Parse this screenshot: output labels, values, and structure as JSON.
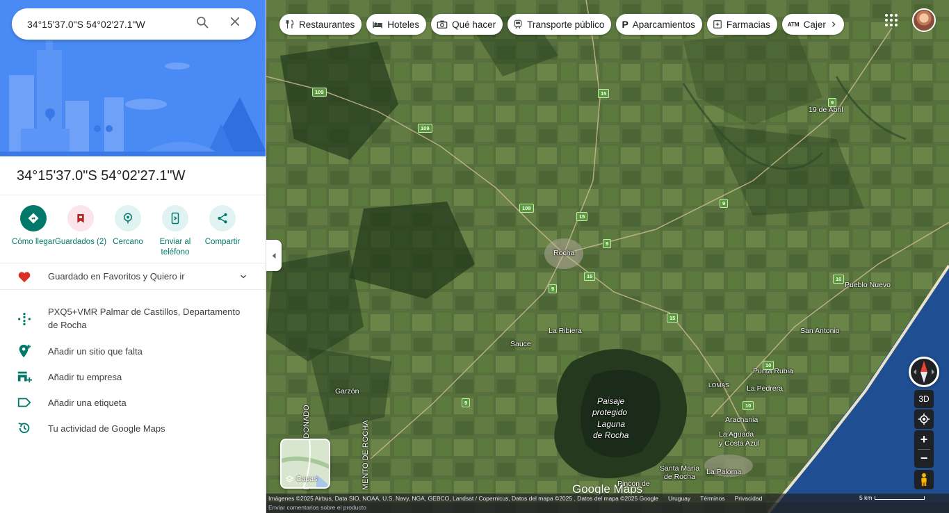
{
  "search": {
    "value": "34°15'37.0\"S 54°02'27.1\"W",
    "search_icon": "search-icon",
    "close_icon": "close-icon"
  },
  "place": {
    "title": "34°15'37.0\"S 54°02'27.1\"W"
  },
  "actions": [
    {
      "label": "Cómo llegar",
      "icon": "directions-icon"
    },
    {
      "label": "Guardados (2)",
      "icon": "bookmark-icon"
    },
    {
      "label": "Cercano",
      "icon": "nearby-icon"
    },
    {
      "label": "Enviar al teléfono",
      "icon": "send-to-phone-icon"
    },
    {
      "label": "Compartir",
      "icon": "share-icon"
    }
  ],
  "saved": {
    "text": "Guardado en Favoritos y Quiero ir",
    "icon": "heart-icon"
  },
  "info_rows": [
    {
      "text": "PXQ5+VMR Palmar de Castillos, Departamento de Rocha",
      "icon": "plus-code-icon"
    },
    {
      "text": "Añadir un sitio que falta",
      "icon": "add-place-icon"
    },
    {
      "text": "Añadir tu empresa",
      "icon": "add-business-icon"
    },
    {
      "text": "Añadir una etiqueta",
      "icon": "label-icon"
    },
    {
      "text": "Tu actividad de Google Maps",
      "icon": "history-icon"
    }
  ],
  "chips": [
    {
      "label": "Restaurantes",
      "icon": "restaurant-icon"
    },
    {
      "label": "Hoteles",
      "icon": "hotel-icon"
    },
    {
      "label": "Qué hacer",
      "icon": "camera-icon"
    },
    {
      "label": "Transporte público",
      "icon": "transit-icon"
    },
    {
      "label": "Aparcamientos",
      "icon": "parking-icon"
    },
    {
      "label": "Farmacias",
      "icon": "pharmacy-icon"
    },
    {
      "label": "Cajer",
      "icon": "atm-icon"
    }
  ],
  "map": {
    "places": {
      "rocha": "Rocha",
      "la_ribiera": "La Ribiera",
      "sauce": "Sauce",
      "garzon": "Garzón",
      "diecinueve_abril": "19 de Abril",
      "pueblo_nuevo": "Pueblo Nuevo",
      "san_antonio": "San Antonio",
      "punta_rubia": "Punta Rubia",
      "la_pedrera": "La Pedrera",
      "lomas": "LOMAS",
      "arachania": "Arachania",
      "la_aguada": "La Aguada",
      "costa_azul": "y Costa Azul",
      "santa_maria": "Santa María",
      "de_rocha": "de Rocha",
      "la_paloma": "La Paloma",
      "pincon": "Pincon de",
      "paisaje_1": "Paisaje",
      "paisaje_2": "protegido",
      "paisaje_3": "Laguna",
      "paisaje_4": "de Rocha",
      "dept_maldonado": "ENTO DE MALDONADO",
      "dept_rocha": "MENTO DE ROCHA"
    },
    "routes": {
      "r109": "109",
      "r15": "15",
      "r9": "9",
      "r10": "10"
    },
    "layers_label": "Capas",
    "control_3d": "3D",
    "zoom_in": "+",
    "zoom_out": "−",
    "google_logo": "Google Maps",
    "attribution": "Imágenes ©2025 Airbus, Data SIO, NOAA, U.S. Navy, NGA, GEBCO, Landsat / Copernicus, Datos del mapa ©2025 , Datos del mapa ©2025 Google",
    "region": "Uruguay",
    "terms": "Términos",
    "privacy": "Privacidad",
    "scale": "5 km",
    "feedback": "Enviar comentarios sobre el producto"
  },
  "colors": {
    "accent": "#00796b",
    "hero_blue": "#4285f4",
    "heart": "#d93025"
  }
}
